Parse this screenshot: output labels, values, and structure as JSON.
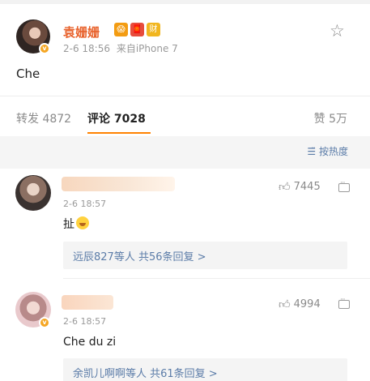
{
  "post": {
    "author": "袁姗姗",
    "badges": [
      "😱",
      "🧧",
      "财"
    ],
    "time": "2-6 18:56",
    "source": "来自iPhone 7",
    "text": "Che",
    "verified_badge": "v"
  },
  "tabs": {
    "repost": "转发 4872",
    "comment": "评论 7028",
    "like": "赞 5万"
  },
  "sort": {
    "label": "按热度",
    "icon": "sort-icon"
  },
  "comments": [
    {
      "time": "2-6 18:57",
      "likes": "7445",
      "text": "扯",
      "reply_summary": "远辰827等人 共56条回复 >"
    },
    {
      "time": "2-6 18:57",
      "likes": "4994",
      "text": "Che du zi",
      "reply_summary": "余凯儿啊啊等人 共61条回复 >"
    }
  ],
  "colors": {
    "name_orange": "#e8622c",
    "link_blue": "#5b7ca8",
    "tab_underline": "#ff8200"
  }
}
